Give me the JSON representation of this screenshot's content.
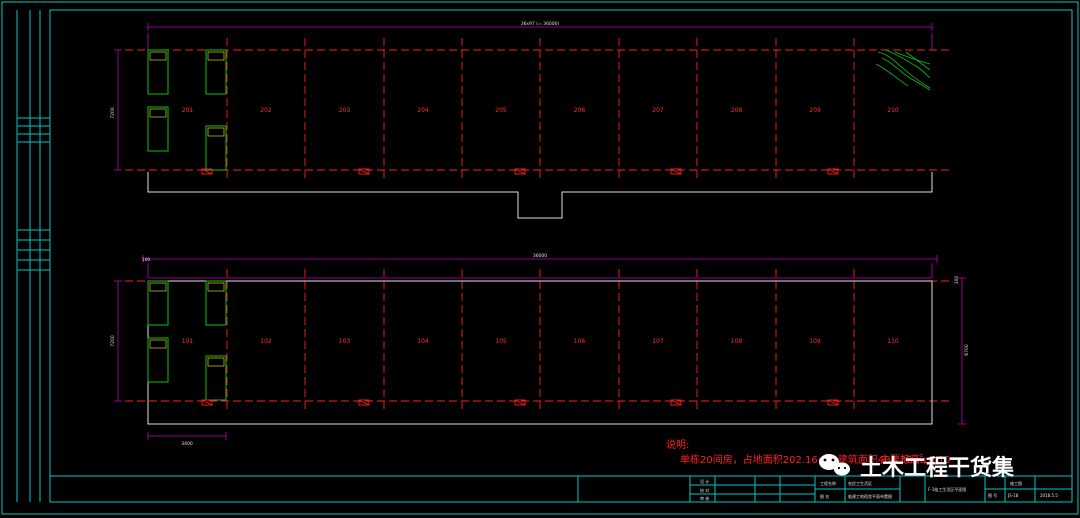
{
  "colors": {
    "frame": "#00c8c8",
    "grid": "#ff2020",
    "dimension": "#c000c0",
    "wall": "#e0e0e0",
    "bed": "#10c010",
    "text_red": "#ff3030"
  },
  "top_floor": {
    "overall_dimension": "36x97 (= 36000)",
    "depth_dimension": "7200",
    "rooms": [
      "201",
      "202",
      "203",
      "204",
      "205",
      "206",
      "207",
      "208",
      "209",
      "210"
    ]
  },
  "bottom_floor": {
    "overall_dimension": "36000",
    "depth_dimension": "7200",
    "right_dimension": "6700",
    "offset_left": "100",
    "offset_right": "100",
    "bay_dimension": "3400",
    "rooms": [
      "101",
      "102",
      "103",
      "104",
      "105",
      "106",
      "107",
      "108",
      "109",
      "110"
    ]
  },
  "notes": {
    "heading": "说明:",
    "body": "单栋20间房，占地面积202.16㎡，建筑面积404.32㎡，",
    "body_tail": "主要标高±0.10"
  },
  "title_block": {
    "cells": [
      "设 计",
      "校 对",
      "审 核"
    ],
    "project_label": "工程名称",
    "project_name": "农民工生活区",
    "drawing_label": "图 名",
    "drawing_name": "临建工地宿舍平面布置图",
    "sheet_title": "F-1临工生活区平面图",
    "drawing_no_label": "图 号",
    "drawing_no": "JS-18",
    "date": "2018.5.5",
    "stage": "施工图"
  },
  "watermark": "土木工程干货集"
}
